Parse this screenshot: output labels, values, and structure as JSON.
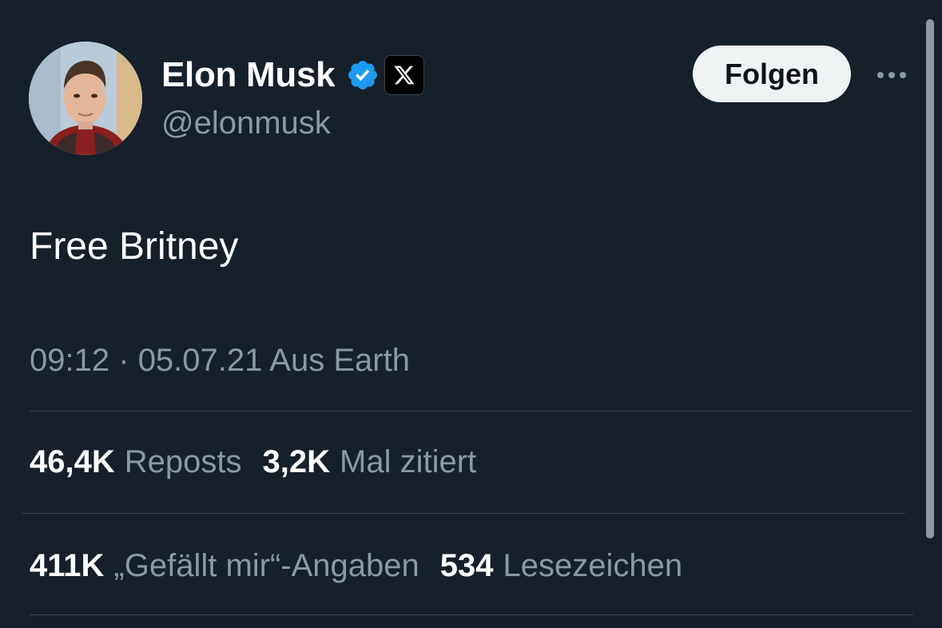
{
  "author": {
    "display_name": "Elon Musk",
    "handle": "@elonmusk",
    "verified": true,
    "affiliation_badge": "x-logo-icon"
  },
  "header": {
    "follow_label": "Folgen",
    "more_icon": "more-horizontal-icon"
  },
  "tweet": {
    "text": "Free Britney",
    "time": "09:12",
    "separator": "·",
    "date": "05.07.21",
    "location": "Aus Earth"
  },
  "stats": {
    "reposts_count": "46,4K",
    "reposts_label": "Reposts",
    "quotes_count": "3,2K",
    "quotes_label": "Mal zitiert",
    "likes_count": "411K",
    "likes_label": "„Gefällt mir“-Angaben",
    "bookmarks_count": "534",
    "bookmarks_label": "Lesezeichen"
  },
  "colors": {
    "background": "#15202b",
    "primary_text": "#ffffff",
    "secondary_text": "#8b98a5",
    "verified_blue": "#1d9bf0",
    "follow_button_bg": "#eff3f4",
    "divider": "#38444d"
  }
}
